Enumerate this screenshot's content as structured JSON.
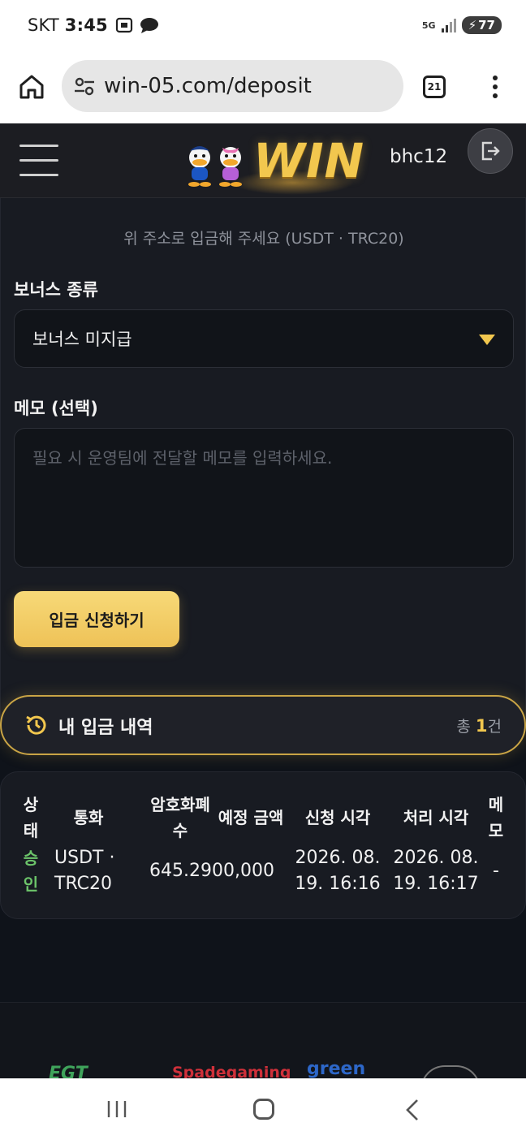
{
  "status_bar": {
    "carrier": "SKT",
    "time": "3:45",
    "network": "5G",
    "battery": "77"
  },
  "browser": {
    "url": "win-05.com/deposit",
    "tab_count": "21"
  },
  "header": {
    "logo_text": "WIN",
    "username": "bhc12"
  },
  "deposit_form": {
    "hint": "위 주소로 입금해 주세요 (USDT · TRC20)",
    "bonus_label": "보너스 종류",
    "bonus_selected": "보너스 미지급",
    "memo_label": "메모 (선택)",
    "memo_placeholder": "필요 시 운영팀에 전달할 메모를 입력하세요.",
    "submit_label": "입금 신청하기"
  },
  "history": {
    "title": "내 입금 내역",
    "count_prefix": "총 ",
    "count": "1",
    "count_suffix": "건",
    "headers": {
      "status": "상태",
      "currency": "통화",
      "crypto_amount": "암호화폐 수",
      "expected_amount": "예정 금액",
      "requested_at": "신청 시각",
      "processed_at": "처리 시각",
      "memo": "메모"
    },
    "rows": [
      {
        "status": "승인",
        "currency": "USDT · TRC20",
        "crypto_amount": "645.29",
        "expected_amount": "00,000",
        "requested_at": "2026. 08. 19. 16:16",
        "processed_at": "2026. 08. 19. 16:17",
        "memo": "-"
      }
    ]
  },
  "footer": {
    "partners": [
      "EGT",
      "Spadegaming",
      "green",
      ""
    ]
  },
  "colors": {
    "accent_gold": "#f2c74e",
    "approved_green": "#6cc46a",
    "page_bg": "#0f131a"
  }
}
